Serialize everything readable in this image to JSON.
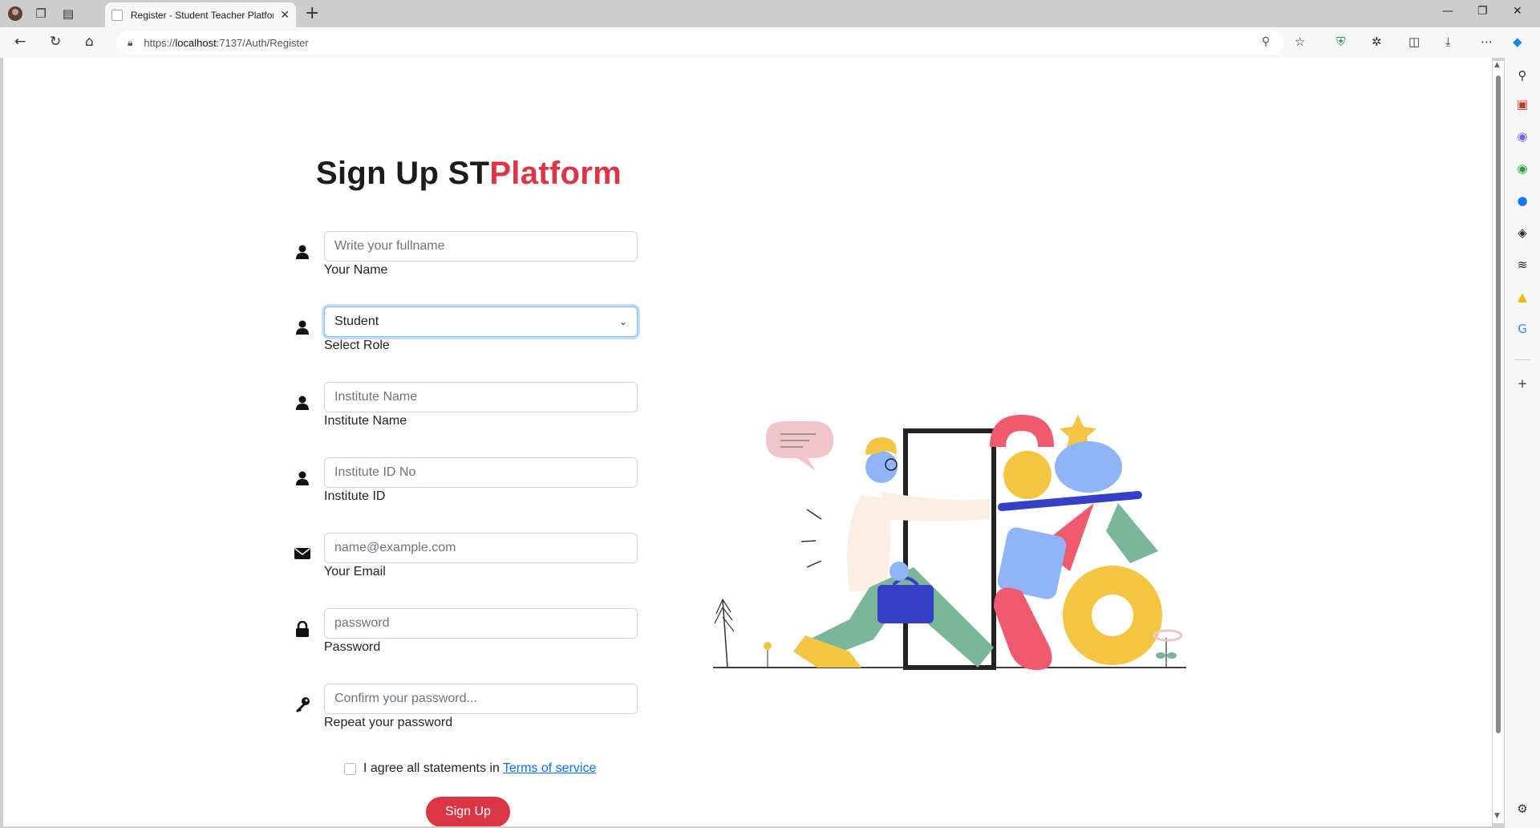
{
  "browser": {
    "tab_title": "Register - Student Teacher Platform",
    "url_prefix": "https://",
    "url_host": "localhost",
    "url_rest": ":7137/Auth/Register"
  },
  "page": {
    "heading_plain": "Sign Up ST",
    "heading_accent": "Platform",
    "fields": [
      {
        "label": "Your Name",
        "placeholder": "Write your fullname",
        "icon": "user-icon"
      },
      {
        "label": "Select Role",
        "value": "Student",
        "icon": "user-icon"
      },
      {
        "label": "Institute Name",
        "placeholder": "Institute Name",
        "icon": "user-icon"
      },
      {
        "label": "Institute ID",
        "placeholder": "Institute ID No",
        "icon": "user-icon"
      },
      {
        "label": "Your Email",
        "placeholder": "name@example.com",
        "icon": "envelope-icon"
      },
      {
        "label": "Password",
        "placeholder": "password",
        "icon": "lock-icon"
      },
      {
        "label": "Repeat your password",
        "placeholder": "Confirm your password...",
        "icon": "key-icon"
      }
    ],
    "agree_text": "I agree all statements in",
    "terms_link": "Terms of service",
    "signup_label": "Sign Up",
    "accent_color": "#dc3545",
    "link_color": "#0d6efd"
  }
}
